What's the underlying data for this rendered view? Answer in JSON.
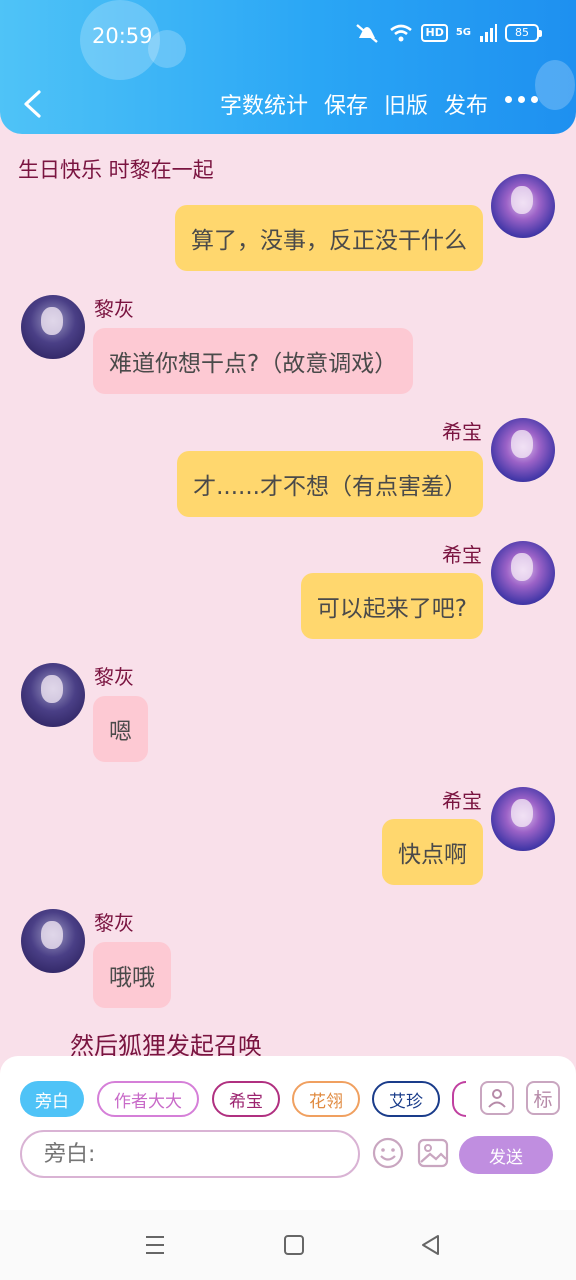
{
  "status_bar": {
    "time": "20:59",
    "network": "5G",
    "hd": "HD",
    "battery": "85"
  },
  "header": {
    "menu": [
      "字数统计",
      "保存",
      "旧版",
      "发布"
    ]
  },
  "chat": {
    "title": "生日快乐 时黎在一起",
    "messages": [
      {
        "side": "me",
        "name": "",
        "text": "算了，没事，反正没干什么"
      },
      {
        "side": "other",
        "name": "黎灰",
        "text": "难道你想干点?（故意调戏）"
      },
      {
        "side": "me",
        "name": "希宝",
        "text": "才......才不想（有点害羞）"
      },
      {
        "side": "me",
        "name": "希宝",
        "text": "可以起来了吧?"
      },
      {
        "side": "other",
        "name": "黎灰",
        "text": "嗯"
      },
      {
        "side": "me",
        "name": "希宝",
        "text": "快点啊"
      },
      {
        "side": "other",
        "name": "黎灰",
        "text": "哦哦"
      }
    ],
    "narration": "然后狐狸发起召唤"
  },
  "composer": {
    "roles": [
      {
        "label": "旁白",
        "color": "#4fc3f7"
      },
      {
        "label": "作者大大",
        "color": "#d57fd8"
      },
      {
        "label": "希宝",
        "color": "#b03080"
      },
      {
        "label": "花翎",
        "color": "#f0a060"
      },
      {
        "label": "艾珍",
        "color": "#1a3c8a"
      },
      {
        "label": "",
        "color": "#c040a0"
      }
    ],
    "tool_icons": [
      "contact-icon",
      "tag-icon"
    ],
    "tag_label": "标",
    "placeholder": "旁白:",
    "send_label": "发送"
  },
  "colors": {
    "header_accent": "#2aa6f5",
    "background": "#f9e0ea",
    "my_bubble": "#ffd76e",
    "other_bubble": "#fdc9d3",
    "name_text": "#7a1440"
  }
}
